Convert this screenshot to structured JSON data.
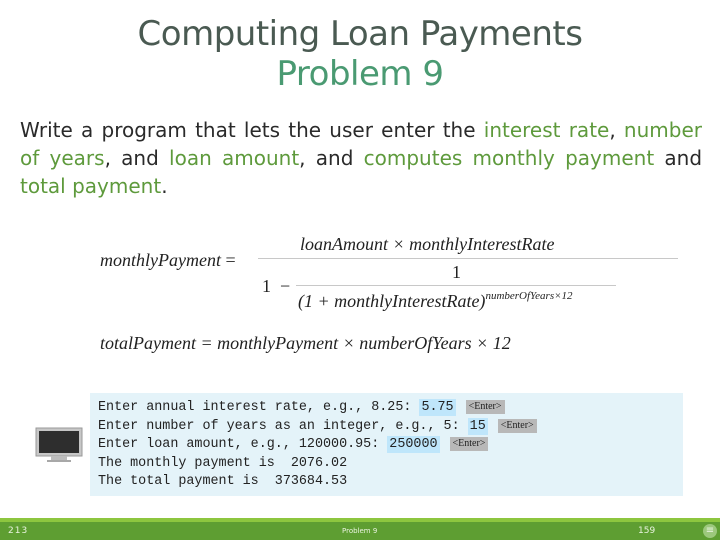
{
  "title": {
    "main": "Computing Loan Payments",
    "sub": "Problem 9"
  },
  "description": {
    "parts": [
      {
        "text": "Write a program that lets the user enter the ",
        "highlight": false
      },
      {
        "text": "interest rate",
        "highlight": true
      },
      {
        "text": ", ",
        "highlight": false
      },
      {
        "text": "number of years",
        "highlight": true
      },
      {
        "text": ", and ",
        "highlight": false
      },
      {
        "text": "loan amount",
        "highlight": true
      },
      {
        "text": ", and ",
        "highlight": false
      },
      {
        "text": "computes monthly payment",
        "highlight": true
      },
      {
        "text": " and ",
        "highlight": false
      },
      {
        "text": "total payment",
        "highlight": true
      },
      {
        "text": ".",
        "highlight": false
      }
    ]
  },
  "formulas": {
    "monthly": {
      "lhs": "monthlyPayment",
      "eq": "=",
      "numerator": "loanAmount × monthlyInterestRate",
      "one": "1",
      "minus": "−",
      "inner_numerator": "1",
      "inner_denominator": "(1 + monthlyInterestRate)",
      "exponent": "numberOfYears×12"
    },
    "total": {
      "text": "totalPayment = monthlyPayment × numberOfYears × 12"
    }
  },
  "console": {
    "lines": [
      {
        "prompt": "Enter annual interest rate, e.g., 8.25: ",
        "input": "5.75",
        "enter": "<Enter>"
      },
      {
        "prompt": "Enter number of years as an integer, e.g., 5: ",
        "input": "15",
        "enter": "<Enter>"
      },
      {
        "prompt": "Enter loan amount, e.g., 120000.95: ",
        "input": "250000",
        "enter": "<Enter>"
      },
      {
        "prompt": "The monthly payment is  2076.02",
        "input": null,
        "enter": null
      },
      {
        "prompt": "The total payment is  373684.53",
        "input": null,
        "enter": null
      }
    ]
  },
  "footer": {
    "slide_number": "213",
    "title": "Problem 9",
    "page_number": "159",
    "menu_icon": "menu-icon"
  },
  "colors": {
    "title": "#4a5a52",
    "subtitle": "#4a9a72",
    "highlight_text": "#5e9a3c",
    "console_bg": "#e4f3f9",
    "input_highlight": "#bfe6fb",
    "footer_bar": "#5e9e32",
    "footer_accent": "#8dc63f"
  }
}
